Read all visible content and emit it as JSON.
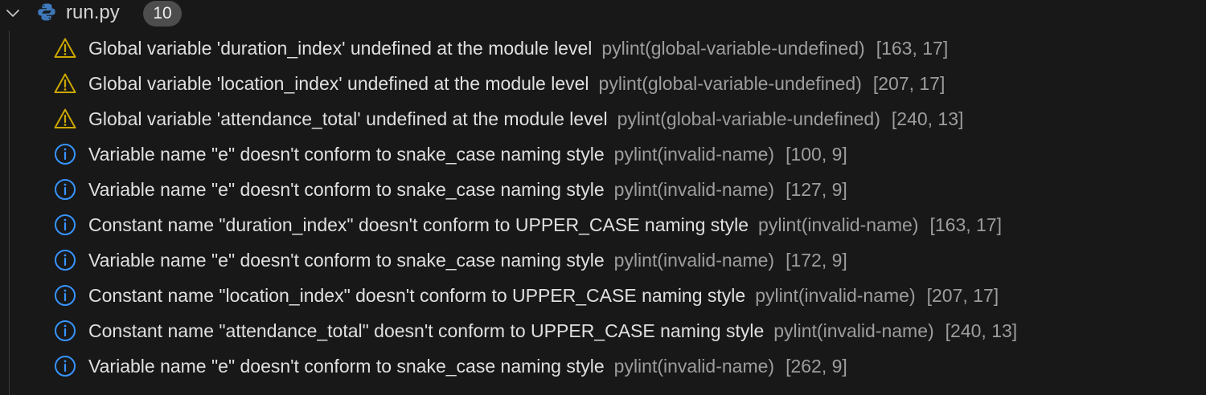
{
  "file": {
    "name": "run.py",
    "count": "10",
    "icon": "python-file-icon",
    "chevron": "chevron-down-icon"
  },
  "colors": {
    "background": "#181818",
    "warning": "#cca700",
    "info": "#3794ff",
    "message": "#e0e0e0",
    "secondary": "#9d9d9d",
    "python_blue": "#3f7bbf",
    "python_yellow": "#f5c842"
  },
  "problems": [
    {
      "severity": "warning",
      "icon": "warning-icon",
      "message": "Global variable 'duration_index' undefined at the module level",
      "source": "pylint(global-variable-undefined)",
      "location": "[163, 17]"
    },
    {
      "severity": "warning",
      "icon": "warning-icon",
      "message": "Global variable 'location_index' undefined at the module level",
      "source": "pylint(global-variable-undefined)",
      "location": "[207, 17]"
    },
    {
      "severity": "warning",
      "icon": "warning-icon",
      "message": "Global variable 'attendance_total' undefined at the module level",
      "source": "pylint(global-variable-undefined)",
      "location": "[240, 13]"
    },
    {
      "severity": "info",
      "icon": "info-icon",
      "message": "Variable name \"e\" doesn't conform to snake_case naming style",
      "source": "pylint(invalid-name)",
      "location": "[100, 9]"
    },
    {
      "severity": "info",
      "icon": "info-icon",
      "message": "Variable name \"e\" doesn't conform to snake_case naming style",
      "source": "pylint(invalid-name)",
      "location": "[127, 9]"
    },
    {
      "severity": "info",
      "icon": "info-icon",
      "message": "Constant name \"duration_index\" doesn't conform to UPPER_CASE naming style",
      "source": "pylint(invalid-name)",
      "location": "[163, 17]"
    },
    {
      "severity": "info",
      "icon": "info-icon",
      "message": "Variable name \"e\" doesn't conform to snake_case naming style",
      "source": "pylint(invalid-name)",
      "location": "[172, 9]"
    },
    {
      "severity": "info",
      "icon": "info-icon",
      "message": "Constant name \"location_index\" doesn't conform to UPPER_CASE naming style",
      "source": "pylint(invalid-name)",
      "location": "[207, 17]"
    },
    {
      "severity": "info",
      "icon": "info-icon",
      "message": "Constant name \"attendance_total\" doesn't conform to UPPER_CASE naming style",
      "source": "pylint(invalid-name)",
      "location": "[240, 13]"
    },
    {
      "severity": "info",
      "icon": "info-icon",
      "message": "Variable name \"e\" doesn't conform to snake_case naming style",
      "source": "pylint(invalid-name)",
      "location": "[262, 9]"
    }
  ]
}
